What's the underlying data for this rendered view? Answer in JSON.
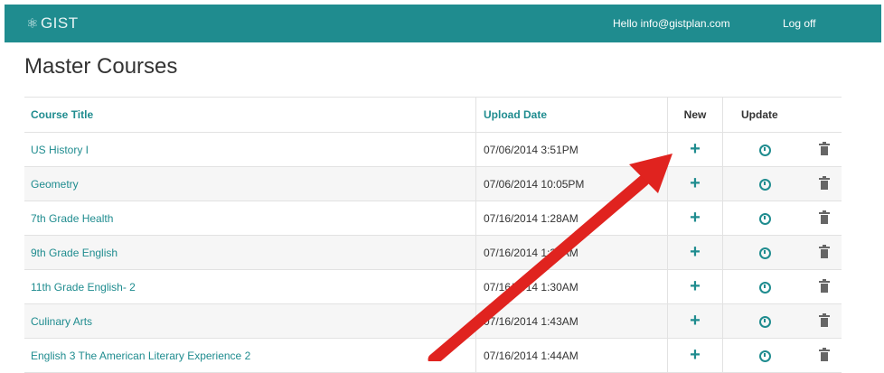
{
  "header": {
    "brand": "GIST",
    "brand_icon": "atom-icon",
    "greeting": "Hello info@gistplan.com",
    "logoff": "Log off"
  },
  "page_title": "Master Courses",
  "table": {
    "columns": {
      "title": "Course Title",
      "upload_date": "Upload Date",
      "new": "New",
      "update": "Update"
    },
    "rows": [
      {
        "title": "US History I",
        "date": "07/06/2014 3:51PM"
      },
      {
        "title": "Geometry",
        "date": "07/06/2014 10:05PM"
      },
      {
        "title": "7th Grade Health",
        "date": "07/16/2014 1:28AM"
      },
      {
        "title": "9th Grade English",
        "date": "07/16/2014 1:30AM"
      },
      {
        "title": "11th Grade English- 2",
        "date": "07/16/2014 1:30AM"
      },
      {
        "title": "Culinary Arts",
        "date": "07/16/2014 1:43AM"
      },
      {
        "title": "English 3 The American Literary Experience 2",
        "date": "07/16/2014 1:44AM"
      }
    ]
  },
  "colors": {
    "accent": "#1f8c8f",
    "annotation_arrow": "#e0231f"
  }
}
